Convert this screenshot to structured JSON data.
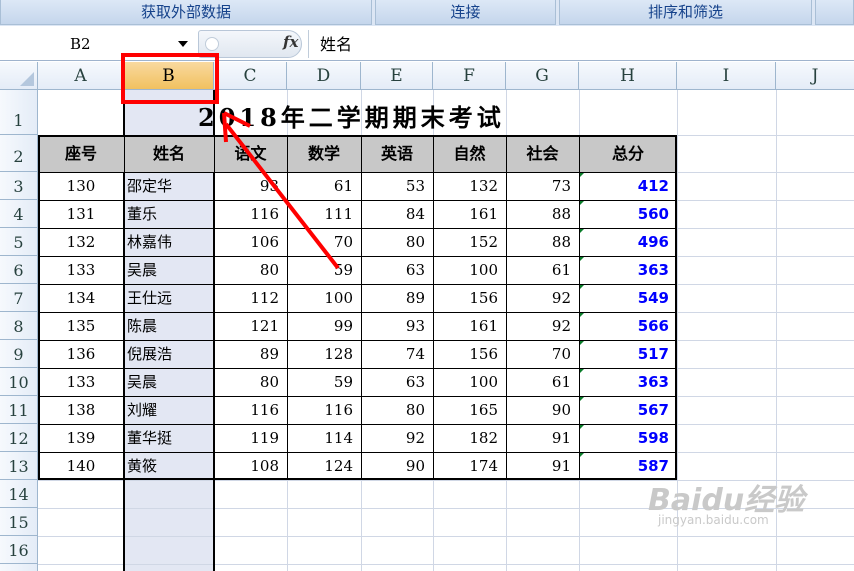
{
  "ribbon": {
    "groups": [
      "获取外部数据",
      "连接",
      "排序和筛选"
    ]
  },
  "formula_bar": {
    "name_box": "B2",
    "fx_label": "fx",
    "content": "姓名"
  },
  "columns": [
    "A",
    "B",
    "C",
    "D",
    "E",
    "F",
    "G",
    "H",
    "I",
    "J"
  ],
  "selected_column": "B",
  "rows": [
    "1",
    "2",
    "3",
    "4",
    "5",
    "6",
    "7",
    "8",
    "9",
    "10",
    "11",
    "12",
    "13",
    "14",
    "15",
    "16"
  ],
  "sheet": {
    "title": "2018年二学期期末考试",
    "headers": [
      "座号",
      "姓名",
      "语文",
      "数学",
      "英语",
      "自然",
      "社会",
      "总分"
    ],
    "records": [
      [
        "130",
        "邵定华",
        "93",
        "61",
        "53",
        "132",
        "73",
        "412"
      ],
      [
        "131",
        "董乐",
        "116",
        "111",
        "84",
        "161",
        "88",
        "560"
      ],
      [
        "132",
        "林嘉伟",
        "106",
        "70",
        "80",
        "152",
        "88",
        "496"
      ],
      [
        "133",
        "吴晨",
        "80",
        "59",
        "63",
        "100",
        "61",
        "363"
      ],
      [
        "134",
        "王仕远",
        "112",
        "100",
        "89",
        "156",
        "92",
        "549"
      ],
      [
        "135",
        "陈晨",
        "121",
        "99",
        "93",
        "161",
        "92",
        "566"
      ],
      [
        "136",
        "倪展浩",
        "89",
        "128",
        "74",
        "156",
        "70",
        "517"
      ],
      [
        "133",
        "吴晨",
        "80",
        "59",
        "63",
        "100",
        "61",
        "363"
      ],
      [
        "138",
        "刘耀",
        "116",
        "116",
        "80",
        "165",
        "90",
        "567"
      ],
      [
        "139",
        "董华挺",
        "119",
        "114",
        "92",
        "182",
        "91",
        "598"
      ],
      [
        "140",
        "黄筱",
        "108",
        "124",
        "90",
        "174",
        "91",
        "587"
      ]
    ]
  },
  "annotation": {
    "highlight_color": "#ff0000"
  },
  "watermark": {
    "brand": "Baidu经验",
    "url": "jingyan.baidu.com"
  }
}
